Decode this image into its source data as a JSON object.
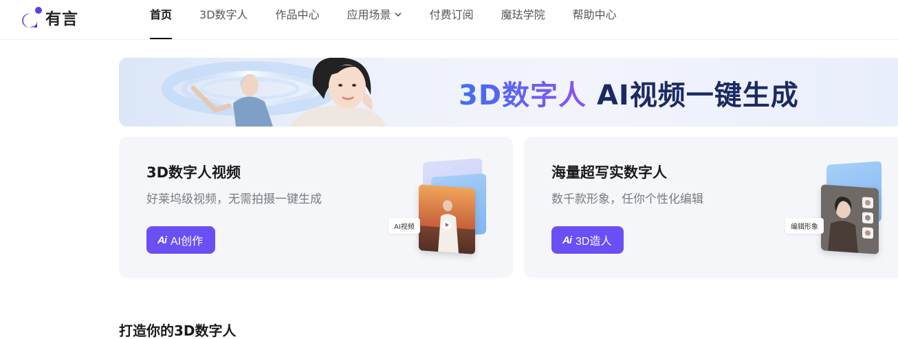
{
  "brand": {
    "name": "有言",
    "accent": "#6a4ff5"
  },
  "nav": {
    "items": [
      {
        "label": "首页",
        "active": true
      },
      {
        "label": "3D数字人"
      },
      {
        "label": "作品中心"
      },
      {
        "label": "应用场景",
        "has_dropdown": true
      },
      {
        "label": "付费订阅"
      },
      {
        "label": "魔珐学院"
      },
      {
        "label": "帮助中心"
      }
    ]
  },
  "banner": {
    "title_highlight": "3D数字人",
    "title_rest": " AI视频一键生成"
  },
  "cards": [
    {
      "title": "3D数字人视频",
      "description": "好莱坞级视频，无需拍摄一键生成",
      "button_icon": "Ai",
      "button_label": "AI创作",
      "art_tag": "AI视频"
    },
    {
      "title": "海量超写实数字人",
      "description": "数千款形象，任你个性化编辑",
      "button_icon": "Ai",
      "button_label": "3D造人",
      "art_tag": "编辑形象"
    }
  ],
  "section": {
    "title": "打造你的3D数字人"
  }
}
